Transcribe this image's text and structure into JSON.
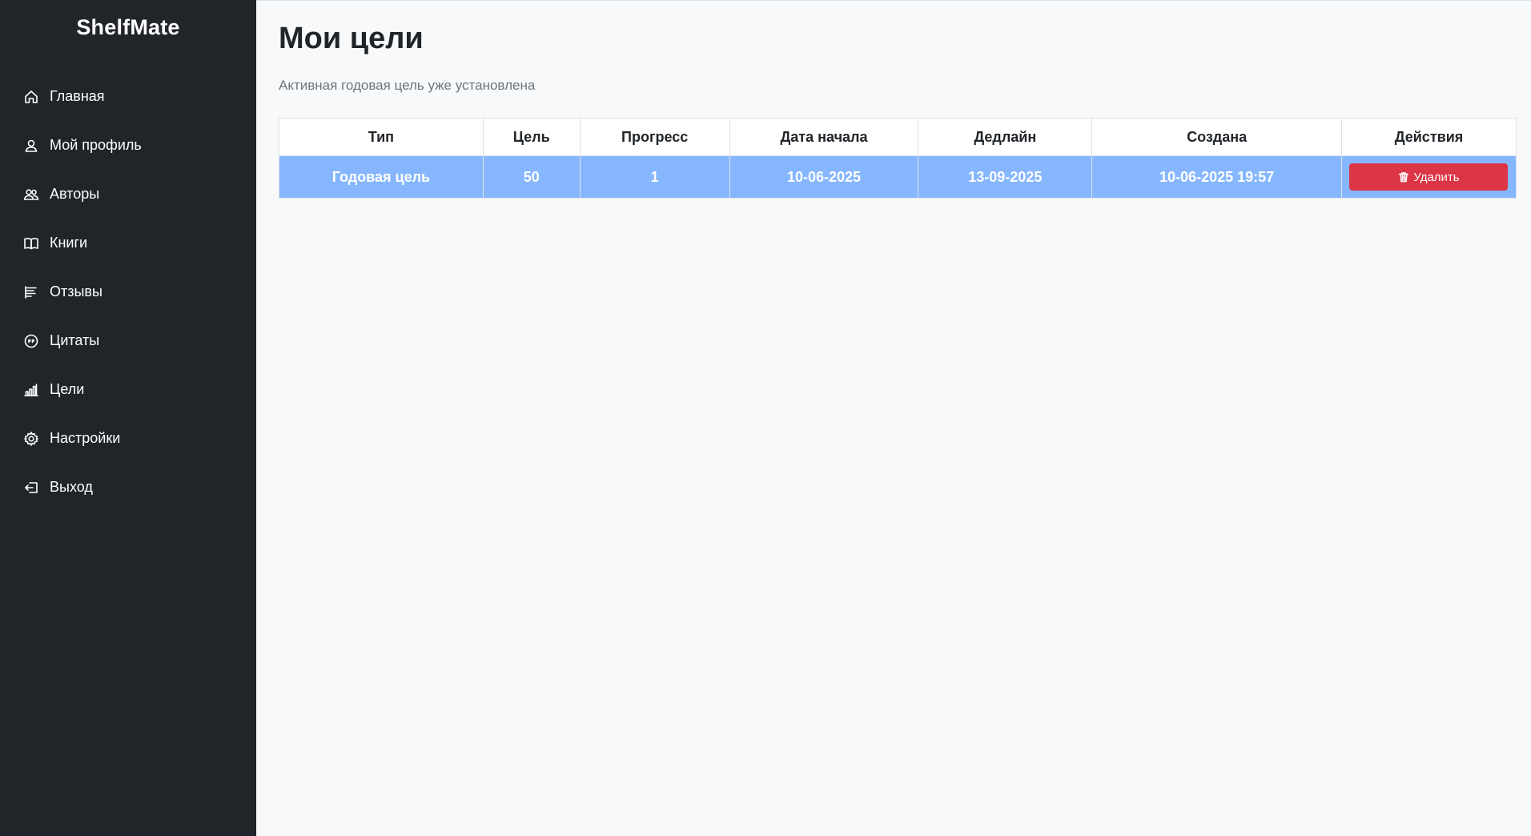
{
  "app": {
    "brand": "ShelfMate"
  },
  "sidebar": {
    "items": [
      {
        "label": "Главная",
        "icon": "home-icon"
      },
      {
        "label": "Мой профиль",
        "icon": "user-icon"
      },
      {
        "label": "Авторы",
        "icon": "people-icon"
      },
      {
        "label": "Книги",
        "icon": "book-icon"
      },
      {
        "label": "Отзывы",
        "icon": "review-icon"
      },
      {
        "label": "Цитаты",
        "icon": "quote-icon"
      },
      {
        "label": "Цели",
        "icon": "bar-chart-icon"
      },
      {
        "label": "Настройки",
        "icon": "gear-icon"
      },
      {
        "label": "Выход",
        "icon": "logout-icon"
      }
    ]
  },
  "page": {
    "title": "Мои цели",
    "subtitle": "Активная годовая цель уже установлена"
  },
  "table": {
    "headers": [
      "Тип",
      "Цель",
      "Прогресс",
      "Дата начала",
      "Дедлайн",
      "Создана",
      "Действия"
    ],
    "rows": [
      {
        "type": "Годовая цель",
        "target": "50",
        "progress": "1",
        "start_date": "10-06-2025",
        "deadline": "13-09-2025",
        "created": "10-06-2025 19:57",
        "delete_label": "Удалить"
      }
    ]
  },
  "colors": {
    "sidebar_bg": "#212529",
    "row_highlight": "#86b7fe",
    "danger": "#dc3545",
    "page_bg": "#f8f9fa"
  }
}
